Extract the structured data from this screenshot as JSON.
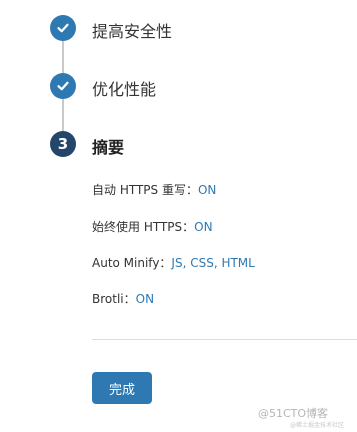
{
  "steps": [
    {
      "label": "提高安全性",
      "state": "done",
      "icon": "check-icon"
    },
    {
      "label": "优化性能",
      "state": "done",
      "icon": "check-icon"
    },
    {
      "label": "摘要",
      "state": "current",
      "number": "3"
    }
  ],
  "summary": {
    "auto_https": {
      "label": "自动 HTTPS 重写：",
      "value": "ON"
    },
    "always_https": {
      "label": "始终使用 HTTPS：",
      "value": "ON"
    },
    "auto_minify": {
      "label": "Auto Minify：",
      "value": "JS, CSS, HTML"
    },
    "brotli": {
      "label": "Brotli：",
      "value": "ON"
    }
  },
  "actions": {
    "done_label": "完成"
  },
  "watermark": {
    "text": "@51CTO博客",
    "subtext": "@稀土掘金技术社区"
  },
  "colors": {
    "accent": "#2f79b2",
    "current_step": "#24466a",
    "connector": "#c9c9c9"
  }
}
